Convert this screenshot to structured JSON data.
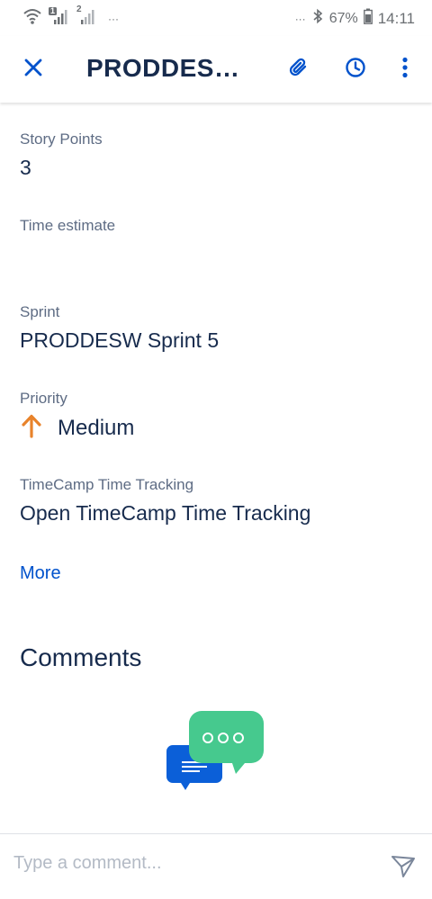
{
  "status_bar": {
    "sim1_badge": "1",
    "sim2_badge": "2",
    "left_more": "···",
    "right_more": "···",
    "battery": "67%",
    "time": "14:11"
  },
  "header": {
    "title": "PRODDESW...",
    "close_icon": "close-icon",
    "attachment_icon": "paperclip-icon",
    "history_icon": "clock-icon",
    "more_icon": "more-vertical-icon",
    "accent_color": "#0052cc"
  },
  "fields": {
    "story_points": {
      "label": "Story Points",
      "value": "3"
    },
    "time_estimate": {
      "label": "Time estimate",
      "value": ""
    },
    "sprint": {
      "label": "Sprint",
      "value": "PRODDESW Sprint 5"
    },
    "priority": {
      "label": "Priority",
      "value": "Medium",
      "icon": "arrow-up-icon",
      "icon_color": "#e8832b"
    },
    "timecamp": {
      "label": "TimeCamp Time Tracking",
      "value": "Open TimeCamp Time Tracking"
    }
  },
  "more_link": "More",
  "comments": {
    "title": "Comments",
    "placeholder": "Type a comment...",
    "send_icon": "send-icon"
  }
}
